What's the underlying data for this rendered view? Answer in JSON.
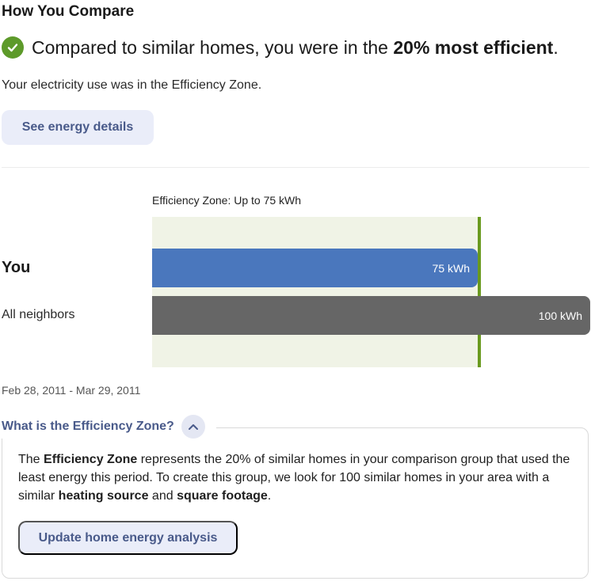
{
  "section_title": "How You Compare",
  "headline": {
    "prefix": "Compared to similar homes, you were in the ",
    "highlight": "20% most efficient",
    "suffix": "."
  },
  "subtext": "Your electricity use was in the Efficiency Zone.",
  "details_button": "See energy details",
  "chart": {
    "zone_label": "Efficiency Zone: Up to 75 kWh",
    "rows": [
      {
        "label": "You",
        "value_label": "75 kWh"
      },
      {
        "label": "All neighbors",
        "value_label": "100 kWh"
      }
    ],
    "date_range": "Feb 28, 2011 - Mar 29, 2011"
  },
  "chart_data": {
    "type": "bar",
    "categories": [
      "You",
      "All neighbors"
    ],
    "values": [
      75,
      100
    ],
    "unit": "kWh",
    "threshold": 75,
    "colors": {
      "you": "#4a77bd",
      "neighbors": "#666666",
      "zone": "#f0f3e6",
      "zone_line": "#6a9a1f"
    }
  },
  "faq": {
    "title": "What is the Efficiency Zone?",
    "body": {
      "t1": "The ",
      "b1": "Efficiency Zone",
      "t2": " represents the 20% of similar homes in your comparison group that used the least energy this period. To create this group, we look for 100 similar homes in your area with a similar ",
      "b2": "heating source",
      "t3": " and ",
      "b3": "square footage",
      "t4": "."
    },
    "update_button": "Update home energy analysis",
    "toggle_icon": "chevron-up-icon"
  },
  "colors": {
    "accent": "#495a8a",
    "button_bg": "#eaedf9",
    "success": "#5d9a2a"
  }
}
